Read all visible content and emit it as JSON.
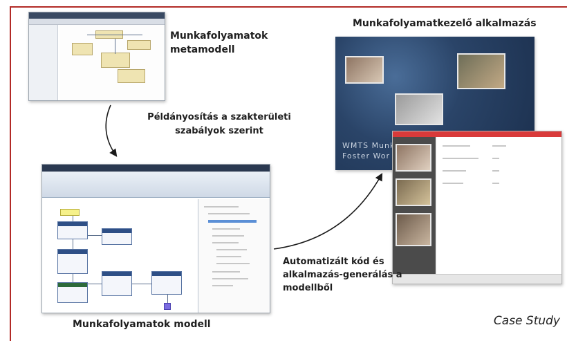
{
  "labels": {
    "metamodel": "Munkafolyamatok metamodell",
    "instantiation": "Példányosítás a szakterületi szabályok szerint",
    "model": "Munkafolyamatok modell",
    "app": "Munkafolyamatkezelő alkalmazás",
    "generation": "Automatizált kód és alkalmazás-generálás a modellből",
    "case_study": "Case Study"
  },
  "app_splash": {
    "line1": "WMTS Munk",
    "line2": "Foster Wor"
  },
  "colors": {
    "frame": "#b22a26",
    "arrow": "#1a1a1a"
  }
}
